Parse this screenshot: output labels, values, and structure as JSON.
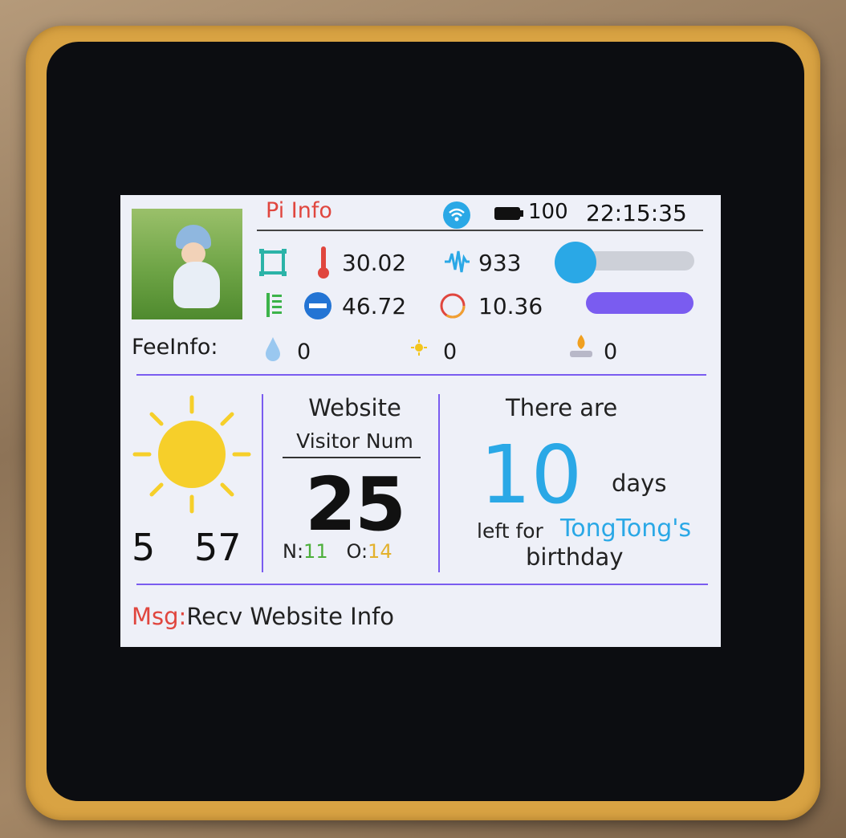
{
  "header": {
    "title": "Pi Info",
    "battery": "100",
    "time": "22:15:35"
  },
  "stats": {
    "temperature": "30.02",
    "wave": "933",
    "free": "46.72",
    "disk": "10.36"
  },
  "bars": {
    "cpu_fraction": 0.1,
    "mem_fraction": 1.0
  },
  "fee": {
    "label": "FeeInfo:",
    "water": "0",
    "electricity": "0",
    "gas": "0"
  },
  "weather": {
    "icon": "sun-icon",
    "hour": "5",
    "minute": "57"
  },
  "website": {
    "line1": "Website",
    "line2": "Visitor Num",
    "visitors": "25",
    "n_label": "N:",
    "n_value": "11",
    "o_label": "O:",
    "o_value": "14"
  },
  "countdown": {
    "prefix": "There are",
    "days": "10",
    "unit": "days",
    "left_for": "left for",
    "who": "TongTong's",
    "event": "birthday"
  },
  "message": {
    "label": "Msg:",
    "text": "Recv Website Info"
  },
  "colors": {
    "accent_blue": "#2aa8e6",
    "accent_purple": "#7a5cf0",
    "title_red": "#e0463e",
    "device_frame": "#d9a343"
  }
}
